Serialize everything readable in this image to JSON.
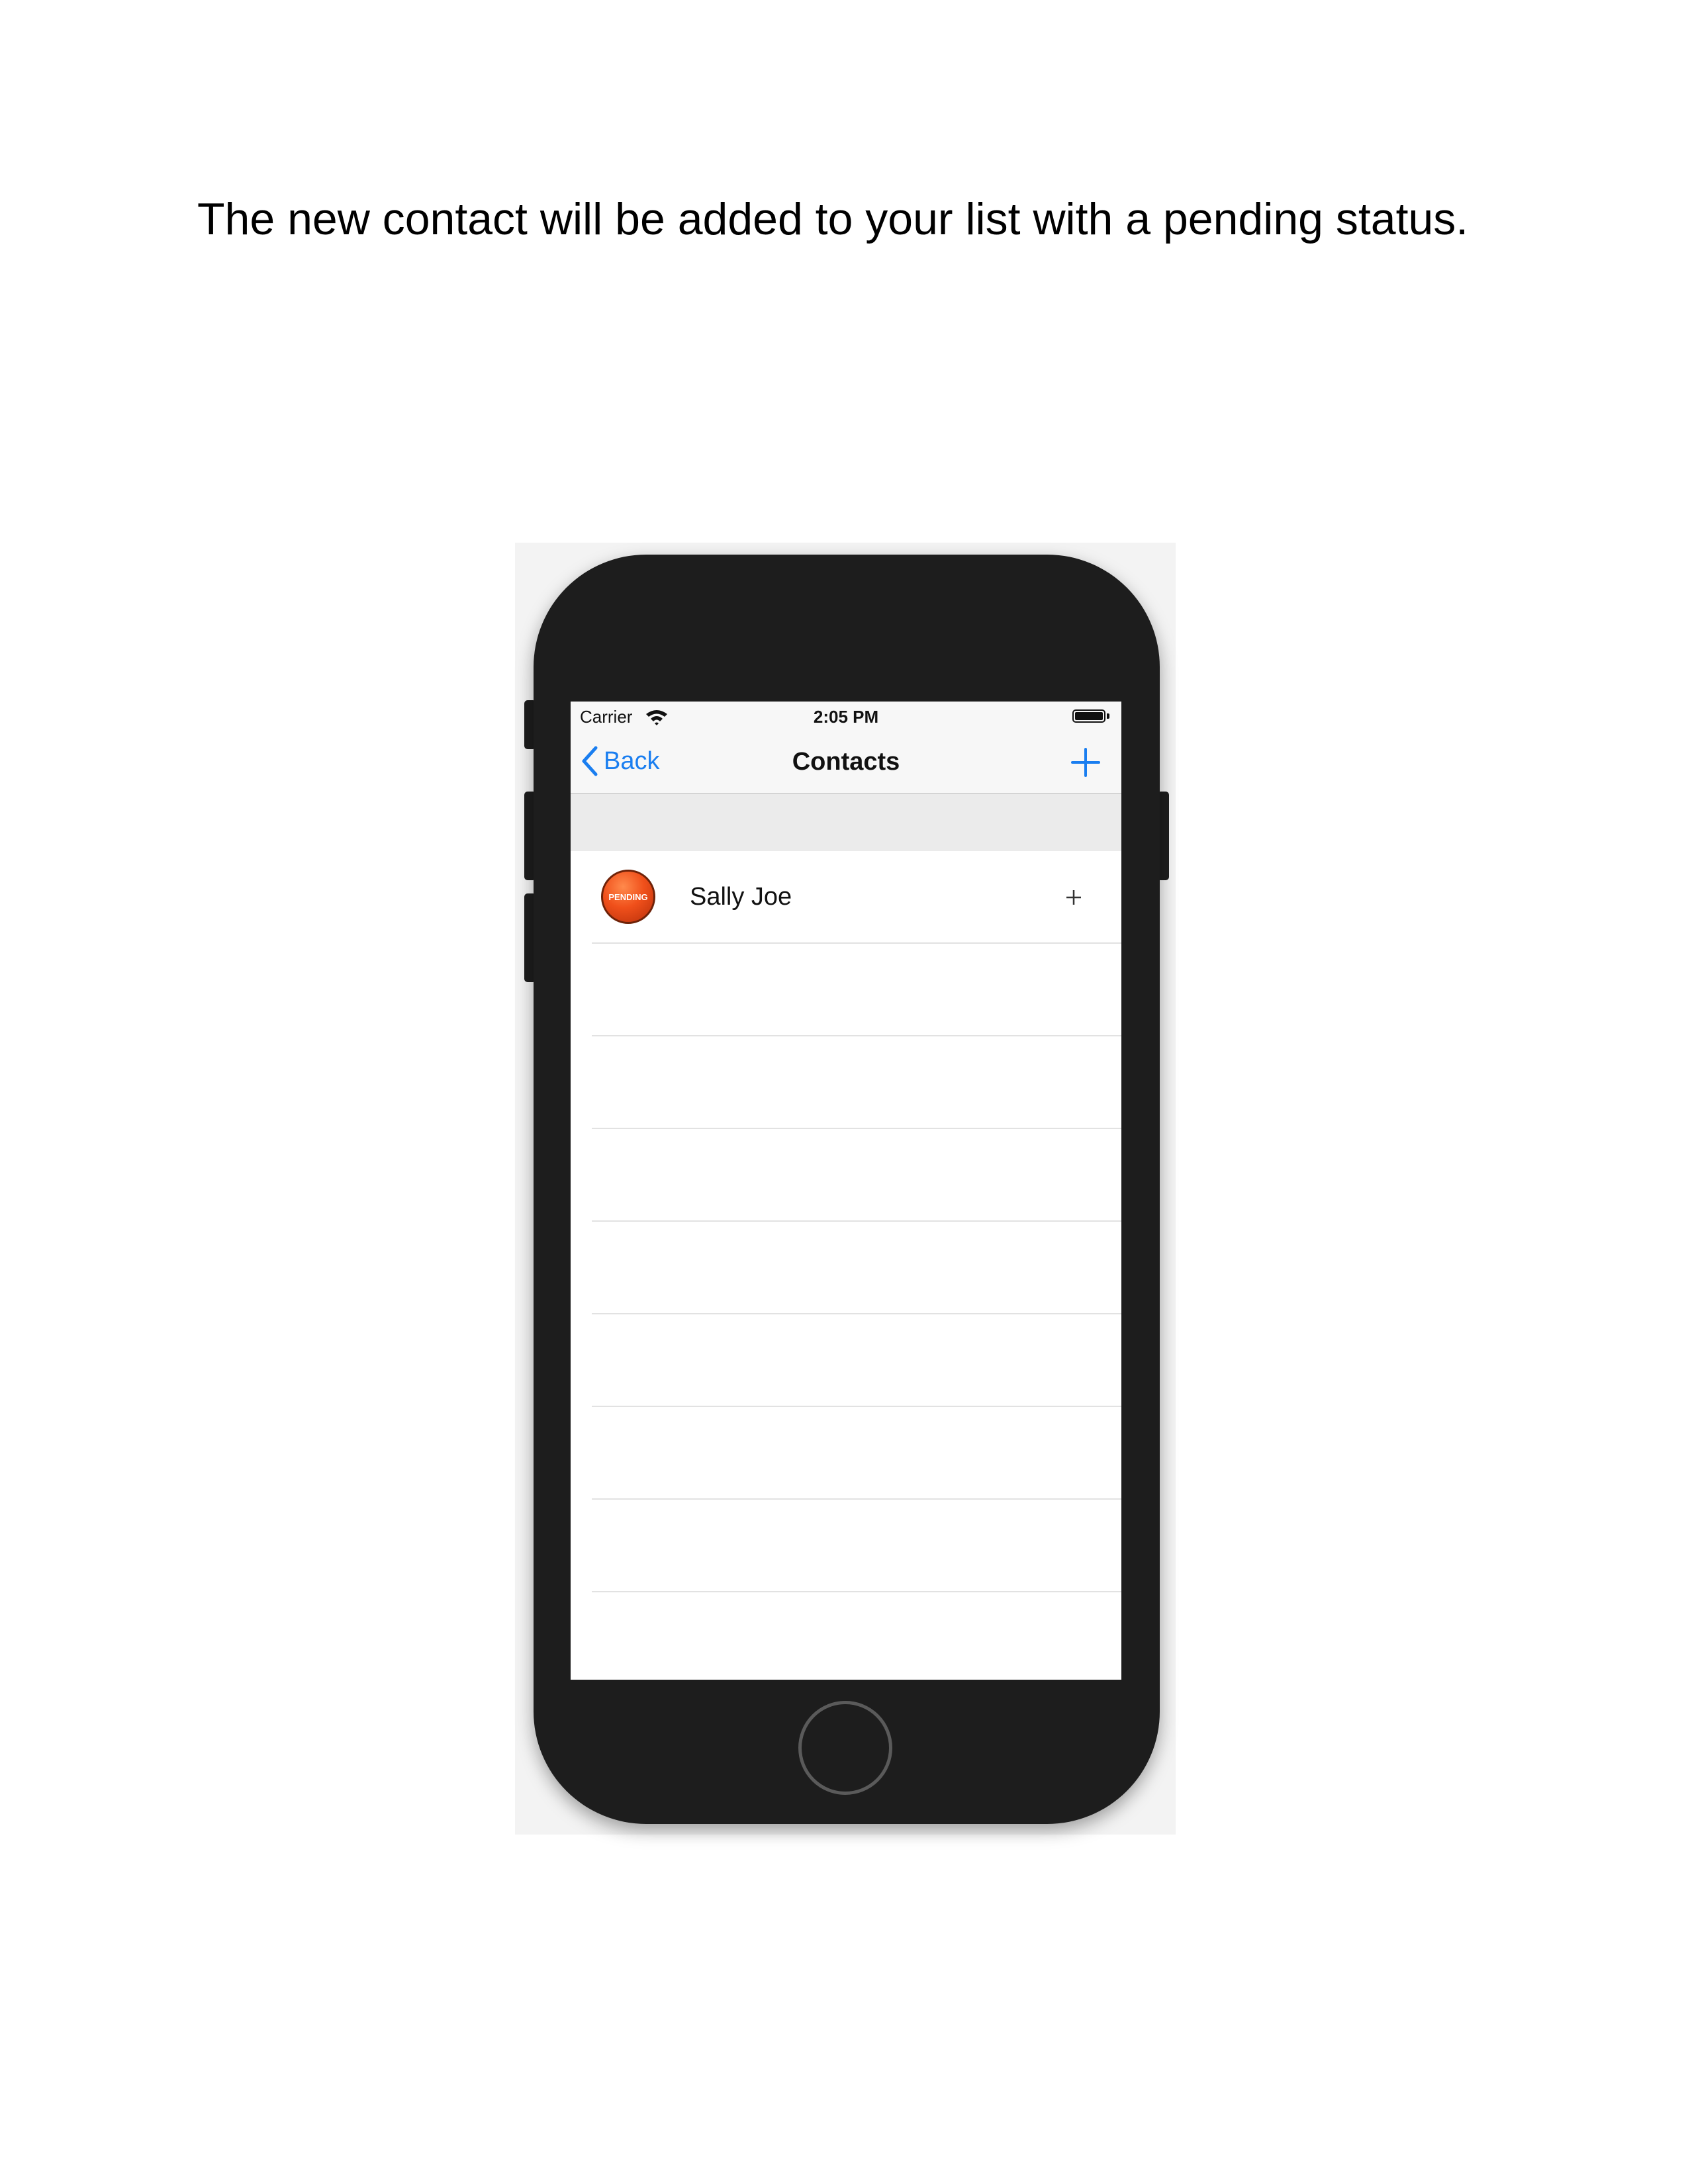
{
  "caption": "The new contact will be added to your list with a pending status.",
  "status_bar": {
    "carrier": "Carrier",
    "time": "2:05 PM"
  },
  "nav": {
    "back_label": "Back",
    "title": "Contacts",
    "add_icon": "plus-icon"
  },
  "contacts": [
    {
      "name": "Sally Joe",
      "avatar_text": "PENDING",
      "action_icon": "plus-icon"
    }
  ],
  "colors": {
    "accent": "#1a7ef0",
    "pending": "#f0501b",
    "device": "#1d1d1d",
    "section_header": "#ebebeb"
  }
}
